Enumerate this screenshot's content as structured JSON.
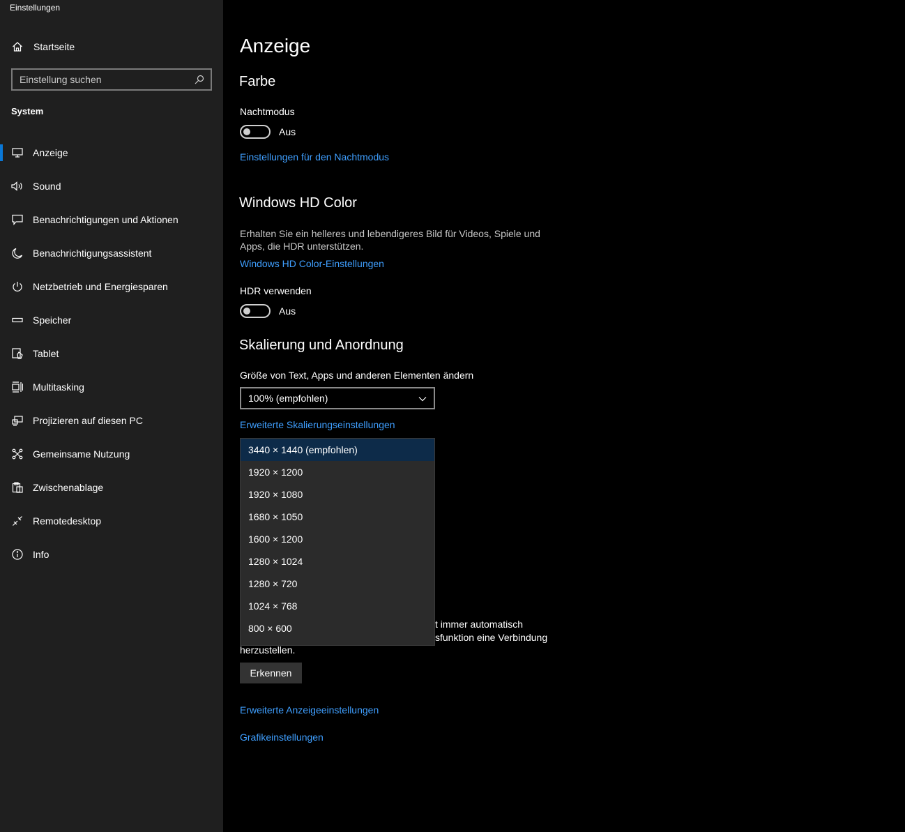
{
  "window": {
    "title": "Einstellungen"
  },
  "sidebar": {
    "home": {
      "label": "Startseite",
      "icon": "home-icon"
    },
    "search": {
      "placeholder": "Einstellung suchen",
      "icon": "search-icon"
    },
    "section": "System",
    "items": [
      {
        "label": "Anzeige",
        "icon": "monitor-icon",
        "active": true
      },
      {
        "label": "Sound",
        "icon": "speaker-icon"
      },
      {
        "label": "Benachrichtigungen und Aktionen",
        "icon": "message-icon"
      },
      {
        "label": "Benachrichtigungsassistent",
        "icon": "moon-icon"
      },
      {
        "label": "Netzbetrieb und Energiesparen",
        "icon": "power-icon"
      },
      {
        "label": "Speicher",
        "icon": "storage-icon"
      },
      {
        "label": "Tablet",
        "icon": "tablet-icon"
      },
      {
        "label": "Multitasking",
        "icon": "multitasking-icon"
      },
      {
        "label": "Projizieren auf diesen PC",
        "icon": "project-icon"
      },
      {
        "label": "Gemeinsame Nutzung",
        "icon": "share-icon"
      },
      {
        "label": "Zwischenablage",
        "icon": "clipboard-icon"
      },
      {
        "label": "Remotedesktop",
        "icon": "remote-icon"
      },
      {
        "label": "Info",
        "icon": "info-icon"
      }
    ]
  },
  "main": {
    "title": "Anzeige",
    "color": {
      "heading": "Farbe",
      "night_label": "Nachtmodus",
      "night_state": "Aus",
      "night_link": "Einstellungen für den Nachtmodus"
    },
    "hd": {
      "heading": "Windows HD Color",
      "desc": "Erhalten Sie ein helleres und lebendigeres Bild für Videos, Spiele und Apps, die HDR unterstützen.",
      "link": "Windows HD Color-Einstellungen",
      "hdr_label": "HDR verwenden",
      "hdr_state": "Aus"
    },
    "scale": {
      "heading": "Skalierung und Anordnung",
      "size_label": "Größe von Text, Apps und anderen Elementen ändern",
      "size_value": "100% (empfohlen)",
      "advanced_link": "Erweiterte Skalierungseinstellungen"
    },
    "detect": {
      "text_line1": "t immer automatisch",
      "text_line2": "sfunktion eine Verbindung",
      "text_line3": "herzustellen.",
      "button": "Erkennen"
    },
    "links": {
      "advanced_display": "Erweiterte Anzeigeeinstellungen",
      "graphics": "Grafikeinstellungen"
    }
  },
  "resolution_dropdown": {
    "options": [
      "3440 × 1440 (empfohlen)",
      "1920 × 1200",
      "1920 × 1080",
      "1680 × 1050",
      "1600 × 1200",
      "1280 × 1024",
      "1280 × 720",
      "1024 × 768",
      "800 × 600"
    ],
    "selected": "3440 × 1440 (empfohlen)"
  },
  "colors": {
    "accent": "#0a78d7",
    "link": "#3f9fff",
    "sidebar_bg": "#1f1f1f",
    "main_bg": "#000000",
    "selected_option": "#0d2b49"
  }
}
